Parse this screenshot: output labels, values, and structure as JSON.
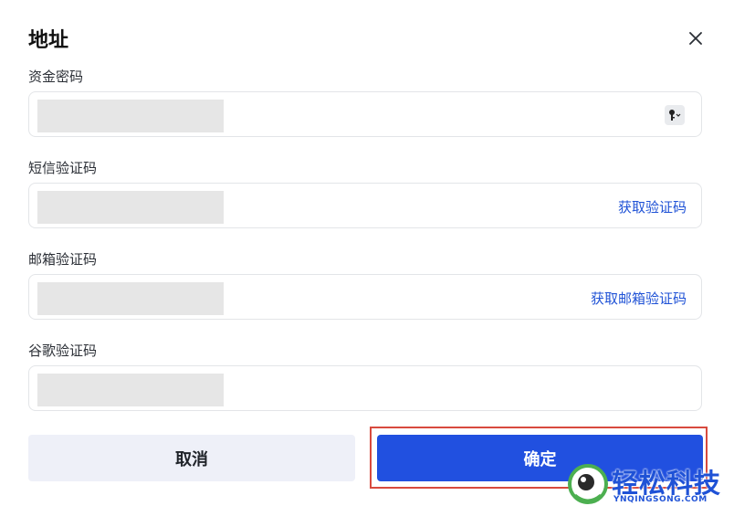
{
  "dialog": {
    "title": "地址",
    "close_icon": "close-icon"
  },
  "fields": [
    {
      "label": "资金密码",
      "action": "",
      "icon": "key-icon"
    },
    {
      "label": "短信验证码",
      "action": "获取验证码"
    },
    {
      "label": "邮箱验证码",
      "action": "获取邮箱验证码"
    },
    {
      "label": "谷歌验证码",
      "action": ""
    }
  ],
  "buttons": {
    "cancel": "取消",
    "confirm": "确定"
  },
  "watermark": {
    "brand": "轻松科技",
    "domain": "YNQINGSONG.COM"
  },
  "colors": {
    "accent": "#2150e0",
    "link": "#1f52d6",
    "highlight_border": "#d84a3e",
    "cancel_bg": "#eef0f8"
  }
}
